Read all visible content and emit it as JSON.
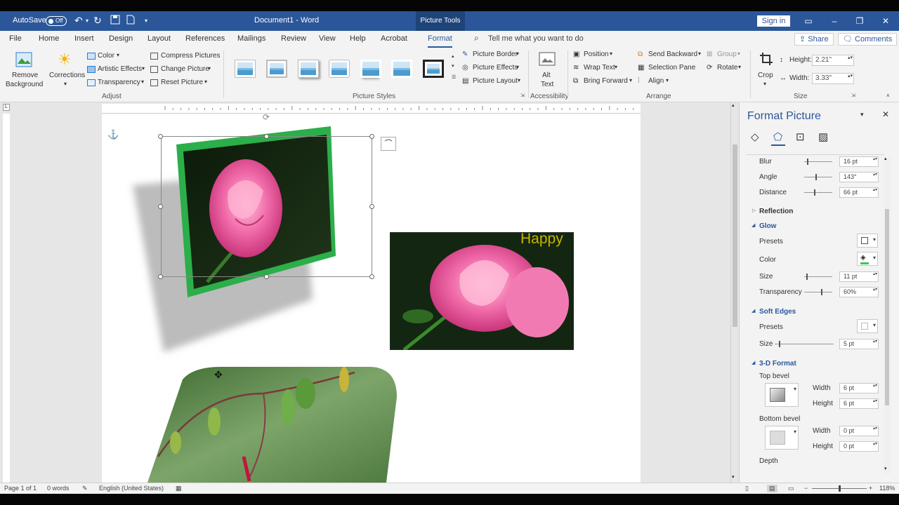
{
  "titlebar": {
    "autosave_label": "AutoSave",
    "autosave_state": "Off",
    "doc_title": "Document1 - Word",
    "picture_tools": "Picture Tools",
    "sign_in": "Sign in"
  },
  "tabs": [
    "File",
    "Home",
    "Insert",
    "Design",
    "Layout",
    "References",
    "Mailings",
    "Review",
    "View",
    "Help",
    "Acrobat",
    "Format"
  ],
  "tell_me": "Tell me what you want to do",
  "share": "Share",
  "comments": "Comments",
  "ribbon": {
    "remove_bg_1": "Remove",
    "remove_bg_2": "Background",
    "corrections": "Corrections",
    "color": "Color",
    "artistic": "Artistic Effects",
    "transparency": "Transparency",
    "compress": "Compress Pictures",
    "change": "Change Picture",
    "reset": "Reset Picture",
    "adjust": "Adjust",
    "pic_border": "Picture Border",
    "pic_effects": "Picture Effects",
    "pic_layout": "Picture Layout",
    "picture_styles": "Picture Styles",
    "alt_1": "Alt",
    "alt_2": "Text",
    "accessibility": "Accessibility",
    "position": "Position",
    "wrap": "Wrap Text",
    "bring": "Bring Forward",
    "send": "Send Backward",
    "sel_pane": "Selection Pane",
    "align": "Align",
    "group": "Group",
    "rotate": "Rotate",
    "arrange": "Arrange",
    "crop": "Crop",
    "height_label": "Height:",
    "height_val": "2.21\"",
    "width_label": "Width:",
    "width_val": "3.33\"",
    "size": "Size"
  },
  "doc": {
    "happy_text": "Happy"
  },
  "pane": {
    "title": "Format Picture",
    "blur_label": "Blur",
    "blur_val": "16 pt",
    "angle_label": "Angle",
    "angle_val": "143°",
    "distance_label": "Distance",
    "distance_val": "66 pt",
    "reflection": "Reflection",
    "glow": "Glow",
    "glow_presets": "Presets",
    "glow_color": "Color",
    "glow_size_label": "Size",
    "glow_size_val": "11 pt",
    "glow_trans_label": "Transparency",
    "glow_trans_val": "60%",
    "soft_edges": "Soft Edges",
    "soft_presets": "Presets",
    "soft_size_label": "Size",
    "soft_size_val": "5 pt",
    "format_3d": "3-D Format",
    "top_bevel": "Top bevel",
    "tb_width_label": "Width",
    "tb_width_val": "6 pt",
    "tb_height_label": "Height",
    "tb_height_val": "6 pt",
    "bottom_bevel": "Bottom bevel",
    "bb_width_label": "Width",
    "bb_width_val": "0 pt",
    "bb_height_label": "Height",
    "bb_height_val": "0 pt",
    "depth": "Depth"
  },
  "status": {
    "page": "Page 1 of 1",
    "words": "0 words",
    "language": "English (United States)",
    "zoom": "118%"
  },
  "colors": {
    "title_blue": "#2b579a",
    "glow_green": "#3ec45a",
    "rose_pink": "#f06aa8"
  }
}
